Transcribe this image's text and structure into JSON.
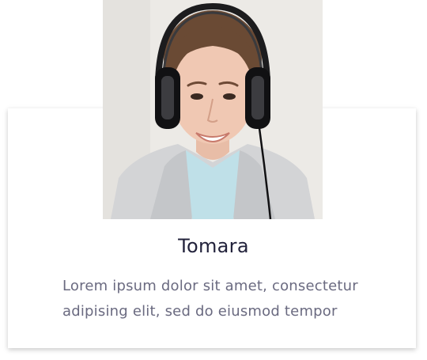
{
  "profile": {
    "name": "Tomara",
    "bio": "Lorem ipsum dolor sit amet, consectetur adipising elit, sed do eiusmod tempor",
    "photo_subject": "woman-with-headphones"
  },
  "colors": {
    "name_text": "#22223b",
    "bio_text": "#6a6a80",
    "card_bg": "#ffffff",
    "photo_bg": "#ecebe8"
  }
}
